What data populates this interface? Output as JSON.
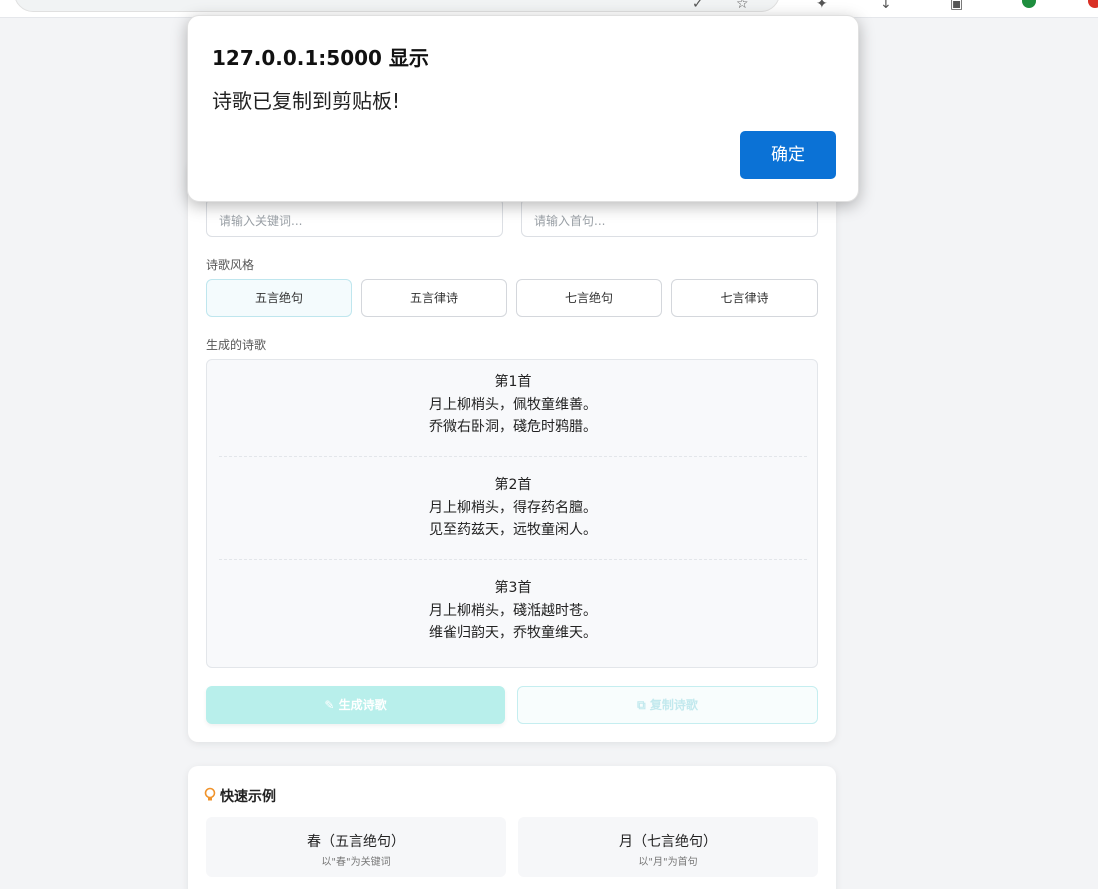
{
  "form": {
    "keyword_placeholder": "请输入关键词...",
    "firstline_placeholder": "请输入首句..."
  },
  "style_section": {
    "label": "诗歌风格",
    "options": [
      "五言绝句",
      "五言律诗",
      "七言绝句",
      "七言律诗"
    ],
    "selected": "五言绝句"
  },
  "output": {
    "label": "生成的诗歌",
    "poems": [
      {
        "title": "第1首",
        "line1": "月上柳梢头，佩牧童维善。",
        "line2": "乔微右卧洞，碊危时鸦腊。"
      },
      {
        "title": "第2首",
        "line1": "月上柳梢头，得存药名膻。",
        "line2": "见至药兹天，远牧童闲人。"
      },
      {
        "title": "第3首",
        "line1": "月上柳梢头，碊湉越时苍。",
        "line2": "维雀归韵天，乔牧童维天。"
      }
    ]
  },
  "actions": {
    "generate_label": "生成诗歌",
    "copy_label": "复制诗歌"
  },
  "examples": {
    "title": "快速示例",
    "items": [
      {
        "title": "春（五言绝句）",
        "subtitle": "以\"春\"为关键词"
      },
      {
        "title": "月（七言绝句）",
        "subtitle": "以\"月\"为首句"
      }
    ]
  },
  "dialog": {
    "title": "127.0.0.1:5000 显示",
    "message": "诗歌已复制到剪贴板!",
    "ok_label": "确定"
  },
  "colors": {
    "accent": "#0b72d6",
    "generate_button": "#b8efeb",
    "selected_style": "#f4fbfd"
  }
}
